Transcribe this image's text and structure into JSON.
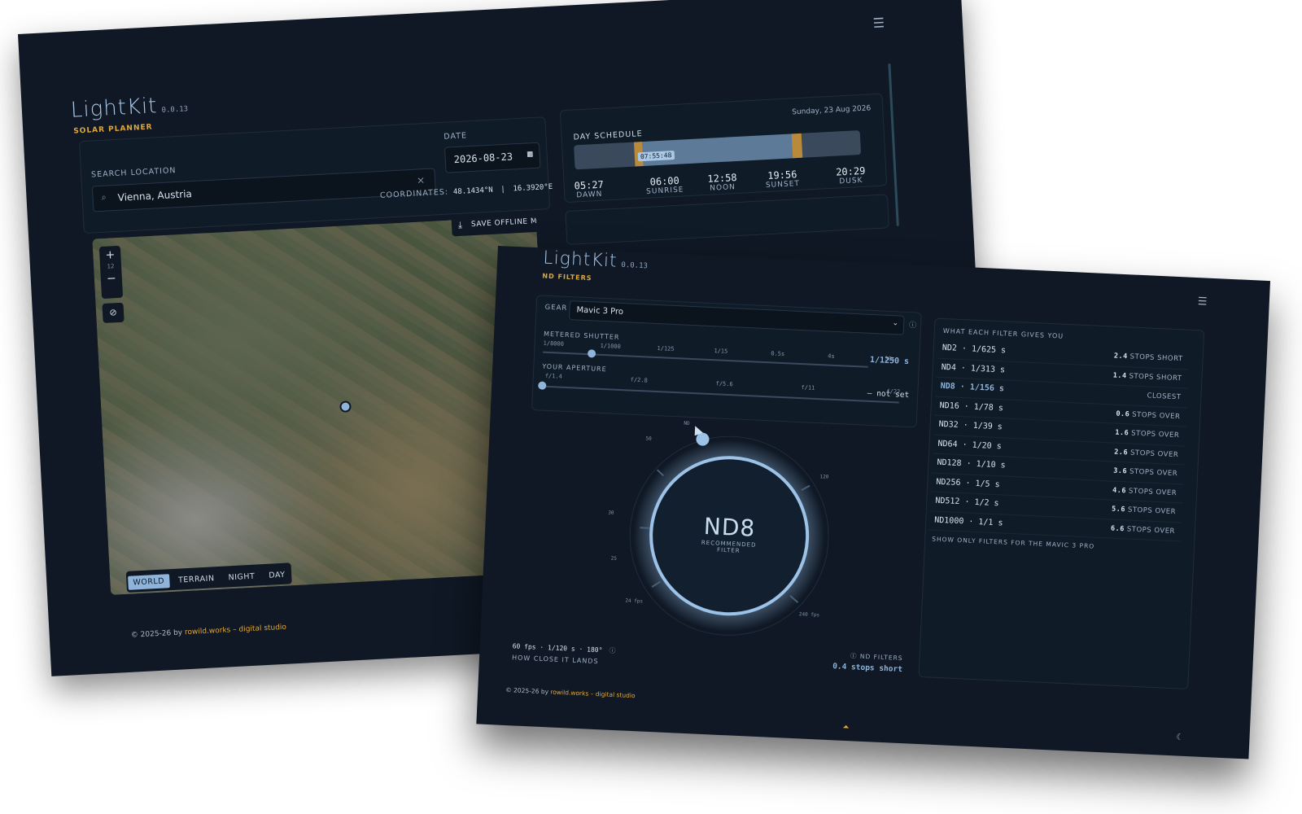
{
  "planner": {
    "app_name": "LightKit",
    "version": "0.0.13",
    "subtitle": "SOLAR PLANNER",
    "menu_icon": "hamburger-icon",
    "search": {
      "label": "SEARCH LOCATION",
      "value": "Vienna, Austria",
      "clear": "×"
    },
    "date": {
      "label": "DATE",
      "value": "2026-08-23"
    },
    "coordinates": {
      "label": "COORDINATES:",
      "lat": "48.1434°N",
      "sep": "|",
      "lon": "16.3920°E"
    },
    "map": {
      "save_offline": "SAVE OFFLINE MAP",
      "zoom_in": "+",
      "zoom_level": "12",
      "zoom_out": "−",
      "layers": [
        "WORLD",
        "TERRAIN",
        "NIGHT",
        "DAY"
      ],
      "active_layer": "WORLD"
    },
    "schedule": {
      "title": "DAY SCHEDULE",
      "date": "Sunday, 23 Aug 2026",
      "current_time": "07:55:48",
      "events": [
        {
          "time": "05:27",
          "name": "DAWN"
        },
        {
          "time": "06:00",
          "name": "SUNRISE"
        },
        {
          "time": "12:58",
          "name": "NOON"
        },
        {
          "time": "19:56",
          "name": "SUNSET"
        },
        {
          "time": "20:29",
          "name": "DUSK"
        }
      ]
    },
    "footer": {
      "copy": "© 2025-26 by",
      "studio": "rowild.works – digital studio"
    }
  },
  "nd": {
    "app_name": "LightKit",
    "version": "0.0.13",
    "subtitle": "ND FILTERS",
    "menu_icon": "hamburger-icon",
    "gear": {
      "label": "GEAR",
      "value": "Mavic 3 Pro"
    },
    "shutter": {
      "label": "METERED SHUTTER",
      "ticks": [
        "1/8000",
        "1/1000",
        "1/125",
        "1/15",
        "0.5s",
        "4s",
        "30s"
      ],
      "value": "1/1250 s",
      "position_fraction": 0.15
    },
    "aperture": {
      "label": "YOUR APERTURE",
      "ticks": [
        "f/1.4",
        "f/2.8",
        "f/5.6",
        "f/11",
        "f/22"
      ],
      "value": "— not set"
    },
    "dial": {
      "filter": "ND8",
      "caption1": "RECOMMENDED",
      "caption2": "FILTER",
      "ticks": [
        "ND",
        "50",
        "120",
        "30",
        "25",
        "24 fps",
        "240 fps"
      ]
    },
    "readout": {
      "fps": "60 fps · 1/120 s · 180°",
      "caption": "HOW CLOSE IT LANDS"
    },
    "result": {
      "label": "ND FILTERS",
      "value": "0.4 stops short"
    },
    "table": {
      "title": "WHAT EACH FILTER GIVES YOU",
      "rows": [
        {
          "filter": "ND2 · 1/625 s",
          "stops": "2.4",
          "note": "STOPS SHORT"
        },
        {
          "filter": "ND4 · 1/313 s",
          "stops": "1.4",
          "note": "STOPS SHORT"
        },
        {
          "filter": "ND8 · 1/156 s",
          "stops": "",
          "note": "CLOSEST"
        },
        {
          "filter": "ND16 · 1/78 s",
          "stops": "0.6",
          "note": "STOPS OVER"
        },
        {
          "filter": "ND32 · 1/39 s",
          "stops": "1.6",
          "note": "STOPS OVER"
        },
        {
          "filter": "ND64 · 1/20 s",
          "stops": "2.6",
          "note": "STOPS OVER"
        },
        {
          "filter": "ND128 · 1/10 s",
          "stops": "3.6",
          "note": "STOPS OVER"
        },
        {
          "filter": "ND256 · 1/5 s",
          "stops": "4.6",
          "note": "STOPS OVER"
        },
        {
          "filter": "ND512 · 1/2 s",
          "stops": "5.6",
          "note": "STOPS OVER"
        },
        {
          "filter": "ND1000 · 1/1 s",
          "stops": "6.6",
          "note": "STOPS OVER"
        }
      ],
      "toggle": "SHOW ONLY FILTERS FOR THE MAVIC 3 PRO"
    },
    "footer": {
      "copy": "© 2025-26 by",
      "studio": "rowild.works – digital studio"
    }
  }
}
